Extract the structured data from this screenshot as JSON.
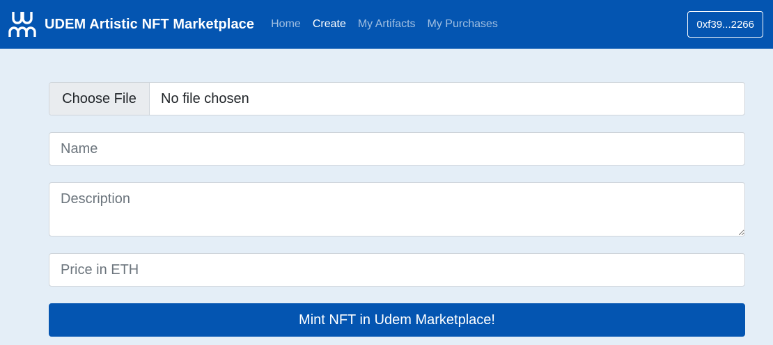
{
  "header": {
    "brand_title": "UDEM Artistic NFT Marketplace",
    "logo_icon": "udem-logo-icon",
    "nav": [
      {
        "label": "Home",
        "active": false
      },
      {
        "label": "Create",
        "active": true
      },
      {
        "label": "My Artifacts",
        "active": false
      },
      {
        "label": "My Purchases",
        "active": false
      }
    ],
    "account": "0xf39...2266"
  },
  "form": {
    "file_button": "Choose File",
    "file_status": "No file chosen",
    "name_placeholder": "Name",
    "description_placeholder": "Description",
    "price_placeholder": "Price in ETH",
    "submit_label": "Mint NFT in Udem Marketplace!"
  },
  "colors": {
    "primary": "#0455b1",
    "page_background": "#e4eef7"
  }
}
